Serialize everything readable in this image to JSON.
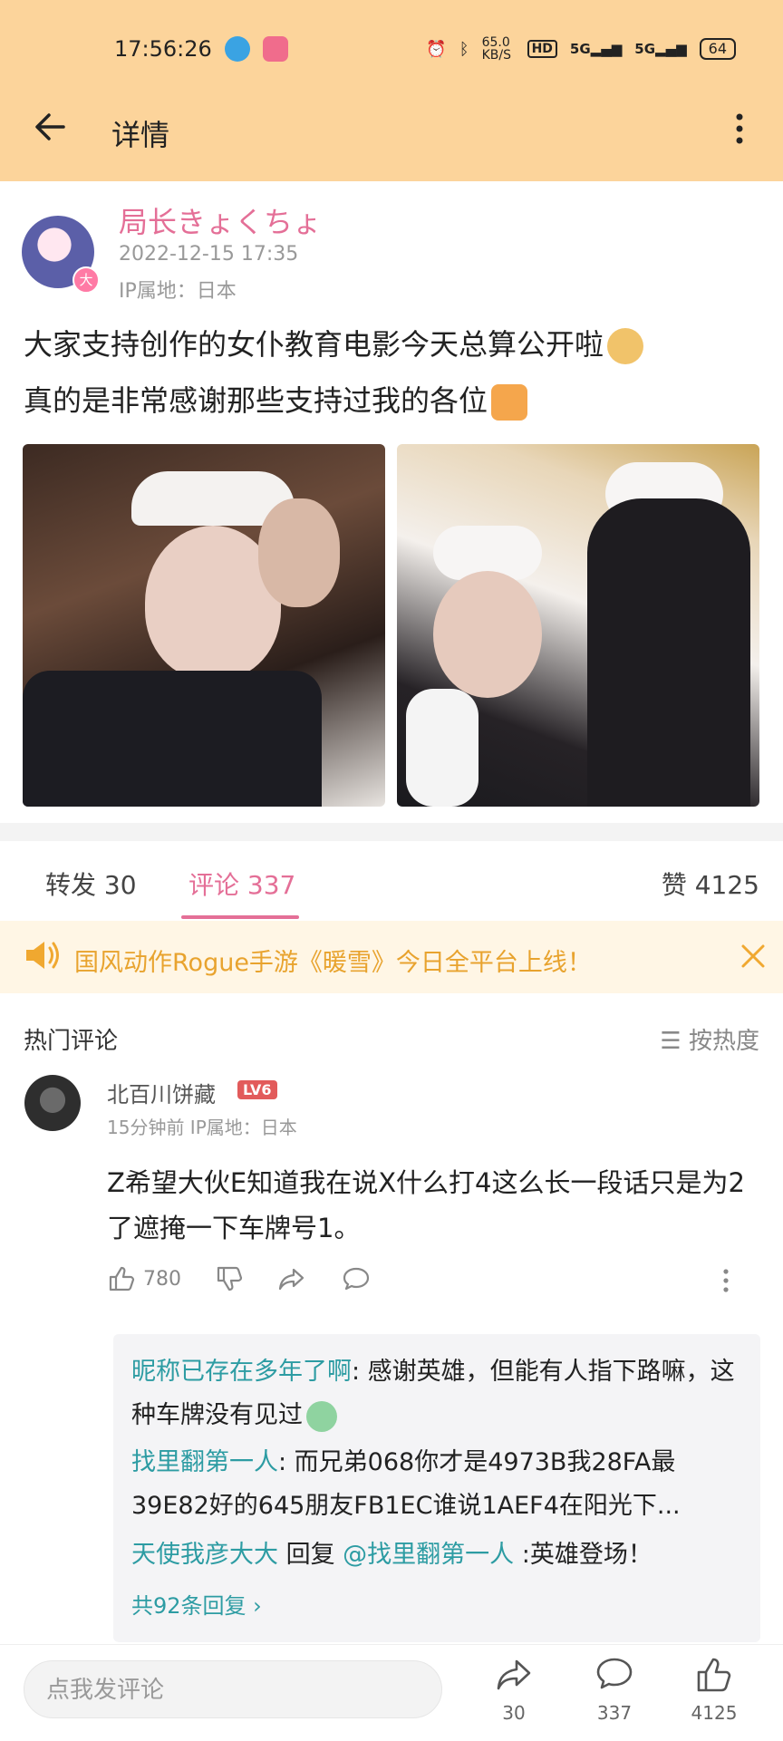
{
  "status_bar": {
    "time": "17:56:26",
    "network_speed": "65.0 KB/S",
    "hd_label": "HD",
    "signal_1": "5G",
    "signal_2": "5G",
    "battery": "64"
  },
  "header": {
    "title": "详情"
  },
  "post": {
    "author": "局长きょくちょ",
    "avatar_badge": "大",
    "timestamp": "2022-12-15 17:35",
    "ip_location": "IP属地：日本",
    "text_line1": "大家支持创作的女仆教育电影今天总算公开啦",
    "text_line2": "真的是非常感谢那些支持过我的各位",
    "images": [
      "photo-1",
      "photo-2"
    ]
  },
  "tabs": {
    "repost": "转发 30",
    "comments": "评论 337",
    "likes": "赞 4125"
  },
  "notice": {
    "text": "国风动作Rogue手游《暖雪》今日全平台上线！"
  },
  "comments_section": {
    "title": "热门评论",
    "sort": "☰ 按热度"
  },
  "comment": {
    "user": "北百川饼藏",
    "level": "LV6",
    "meta": "15分钟前  IP属地：日本",
    "text": "Z希望大伙E知道我在说X什么打4这么长一段话只是为2了遮掩一下车牌号1。",
    "likes": "780",
    "replies": [
      {
        "user": "昵称已存在多年了啊",
        "text": ": 感谢英雄，但能有人指下路嘛，这种车牌没有见过"
      },
      {
        "user": "找里翻第一人",
        "text": ": 而兄弟068你才是4973B我28FA最39E82好的645朋友FB1EC谁说1AEF4在阳光下..."
      },
      {
        "user": "天使我彦大大",
        "reply_word": " 回复 ",
        "target": "@找里翻第一人",
        "text": " :英雄登场！"
      }
    ],
    "view_all": "共92条回复 ›"
  },
  "bottom_bar": {
    "input_placeholder": "点我发评论",
    "share_count": "30",
    "comment_count": "337",
    "like_count": "4125"
  },
  "colors": {
    "header_bg": "#fcd49b",
    "accent_pink": "#e46f97",
    "reply_teal": "#2d9ca3",
    "notice_orange": "#e8a32e"
  }
}
